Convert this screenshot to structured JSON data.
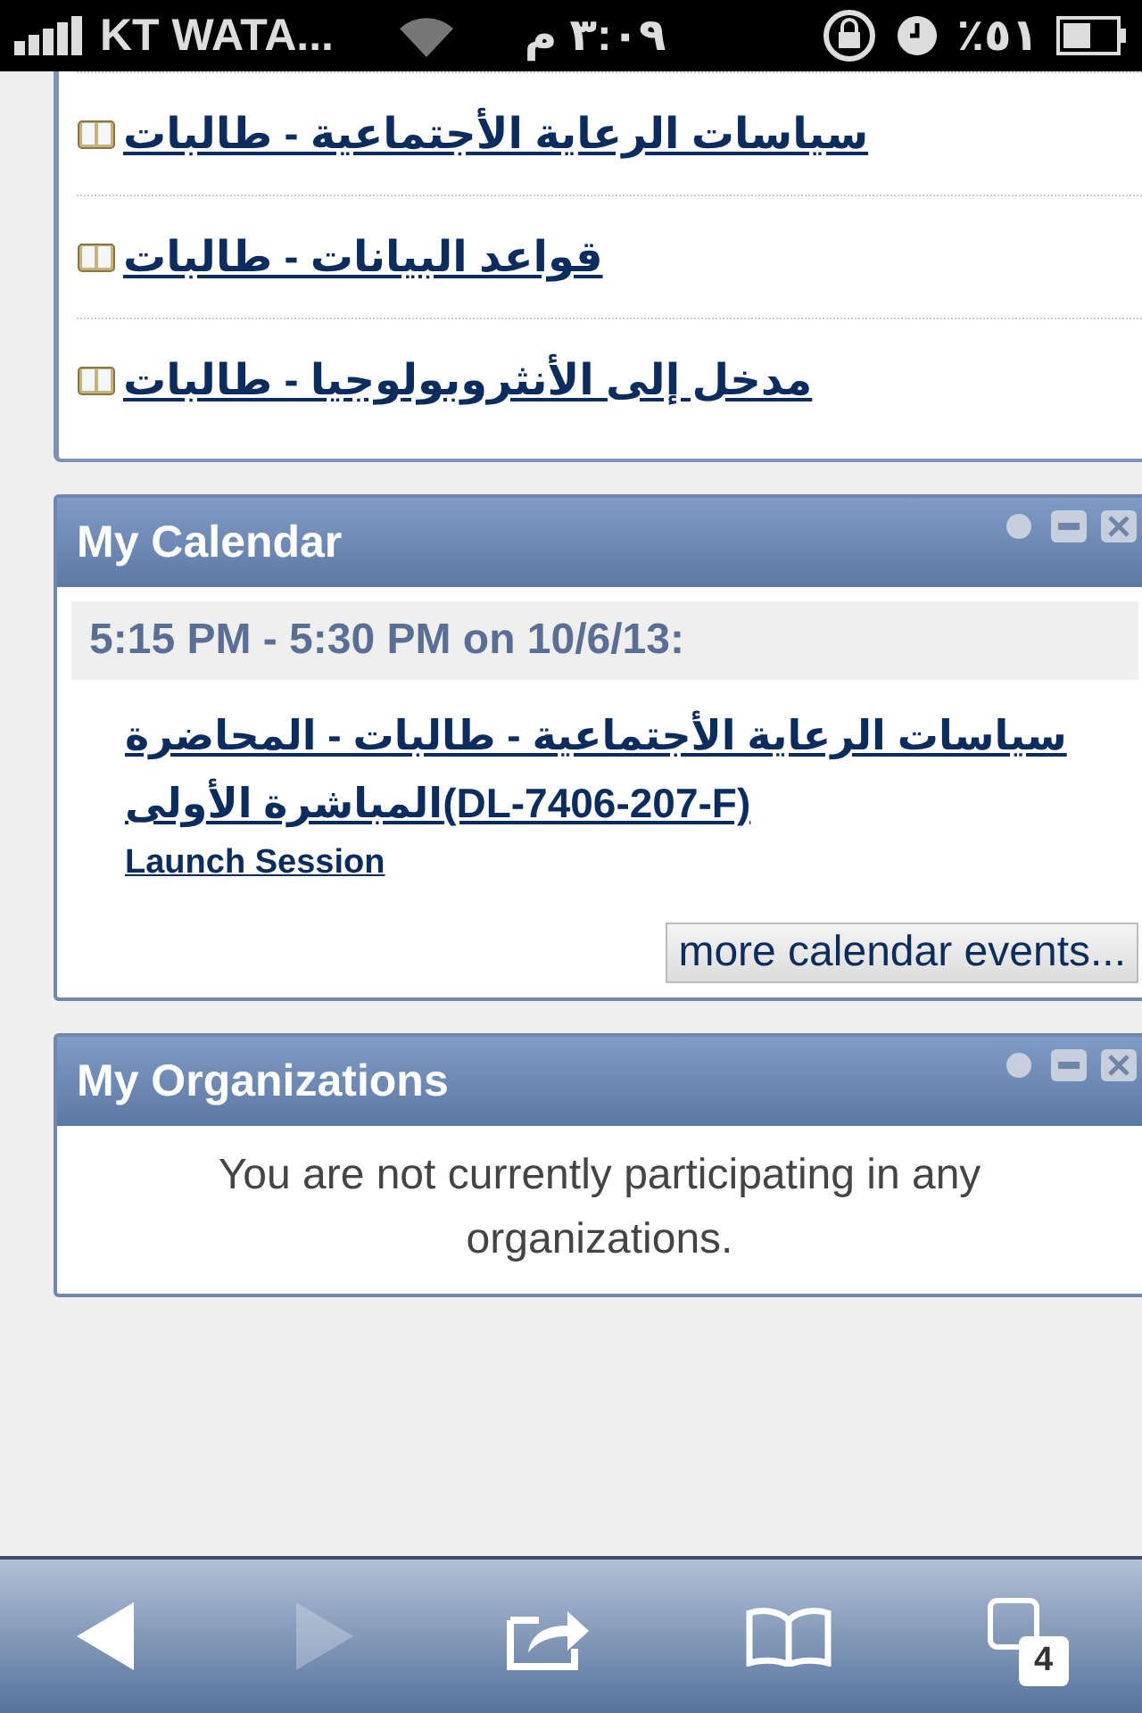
{
  "status_bar": {
    "carrier": "KT WATA...",
    "time": "٣:٠٩ م",
    "battery": "٪٥١"
  },
  "courses": [
    {
      "title": "سياسات الرعاية الأجتماعية - طالبات"
    },
    {
      "title": "قواعد البيانات - طالبات"
    },
    {
      "title": "مدخل إلى الأنثروبولوجيا - طالبات"
    }
  ],
  "calendar": {
    "title": "My Calendar",
    "events": [
      {
        "when": "5:15 PM - 5:30 PM on 10/6/13:",
        "title": "سياسات الرعاية الأجتماعية - طالبات - المحاضرة المباشرة الأولى(DL-7406-207-F)",
        "action": "Launch Session"
      }
    ],
    "more_button": "more calendar events..."
  },
  "organizations": {
    "title": "My Organizations",
    "message": "You are not currently participating in any organizations."
  },
  "toolbar": [
    {
      "kind": "back",
      "disabled": false
    },
    {
      "kind": "forward",
      "disabled": true
    },
    {
      "kind": "share",
      "disabled": false
    },
    {
      "kind": "bookmarks",
      "disabled": false
    },
    {
      "kind": "tabs",
      "disabled": false,
      "count": "4"
    }
  ]
}
